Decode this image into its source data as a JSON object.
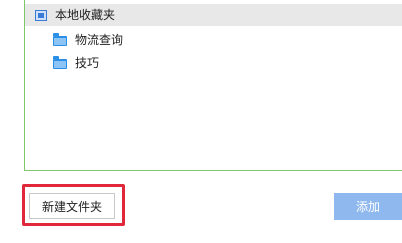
{
  "tree": {
    "root": {
      "label": "本地收藏夹",
      "icon": "favorites-root-icon"
    },
    "folders": [
      {
        "label": "物流查询",
        "icon": "folder-icon"
      },
      {
        "label": "技巧",
        "icon": "folder-icon"
      }
    ]
  },
  "actions": {
    "new_folder_label": "新建文件夹",
    "add_label": "添加"
  },
  "colors": {
    "panel_border": "#7ec86b",
    "selected_row_bg": "#e8e8e8",
    "highlight_border": "#e0283a",
    "add_button_bg": "#8fb8ee",
    "folder_icon": "#2b8fe6"
  }
}
